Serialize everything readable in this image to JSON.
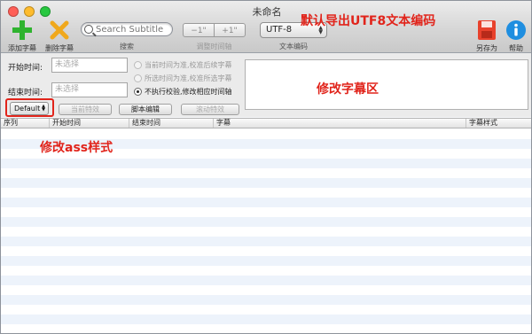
{
  "window": {
    "title": "未命名"
  },
  "toolbar": {
    "add_label": "添加字幕",
    "remove_label": "删除字幕",
    "search_placeholder": "Search Subtitle",
    "search_label": "搜索",
    "shift_minus": "−1\"",
    "shift_plus": "+1\"",
    "shift_label": "调整时间轴",
    "encoding_value": "UTF-8",
    "encoding_label": "文本编码",
    "saveas_label": "另存为",
    "help_label": "帮助",
    "colors": {
      "add_icon": "#2fb32f",
      "remove_icon": "#f0a81c",
      "save_icon": "#e8412c",
      "help_icon": "#1f8ee0"
    }
  },
  "annotations": {
    "export": "默认导出UTF8文本编码",
    "edit_area": "修改字幕区",
    "style": "修改ass样式",
    "color": "#e1241b"
  },
  "editor": {
    "start_label": "开始时间:",
    "end_label": "结束时间:",
    "start_placeholder": "未选择",
    "end_placeholder": "未选择",
    "radio_1": "当前时间为准,校准后续字幕",
    "radio_2": "所选时间为准,校准所选字幕",
    "radio_3": "不执行校验,修改相应时间轴",
    "style_value": "Default",
    "btn_current_effect": "当前特效",
    "btn_script_edit": "脚本编辑",
    "btn_scroll_effect": "滚动特效"
  },
  "table": {
    "columns": [
      "序列",
      "开始时间",
      "结束时间",
      "字幕",
      "字幕样式"
    ],
    "stripe_color": "#edf3fb"
  }
}
